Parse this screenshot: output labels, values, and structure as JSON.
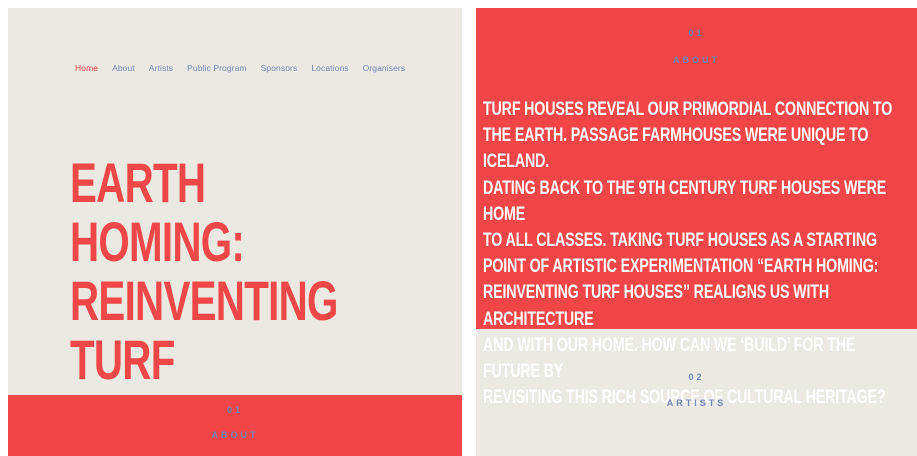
{
  "nav": {
    "items": [
      {
        "label": "Home",
        "active": true
      },
      {
        "label": "About",
        "active": false
      },
      {
        "label": "Artists",
        "active": false
      },
      {
        "label": "Public Program",
        "active": false
      },
      {
        "label": "Sponsors",
        "active": false
      },
      {
        "label": "Locations",
        "active": false
      },
      {
        "label": "Organisers",
        "active": false
      }
    ]
  },
  "hero": {
    "title": "EARTH HOMING:\nREINVENTING TURF\nHOUSES"
  },
  "left_about_section": {
    "number": "01",
    "label": "ABOUT"
  },
  "about_section": {
    "number": "01",
    "label": "ABOUT",
    "text": "TURF HOUSES REVEAL OUR PRIMORDIAL CONNECTION TO\nTHE EARTH. PASSAGE FARMHOUSES WERE UNIQUE TO ICELAND.\nDATING BACK TO THE 9TH CENTURY TURF HOUSES WERE HOME\nTO ALL CLASSES. TAKING TURF HOUSES AS A STARTING\nPOINT OF ARTISTIC EXPERIMENTATION “EARTH HOMING:\nREINVENTING TURF HOUSES” REALIGNS US WITH ARCHITECTURE\nAND WITH OUR HOME. HOW CAN WE ‘BUILD’ FOR THE FUTURE BY\nREVISITING THIS RICH SOURCE OF CULTURAL HERITAGE?"
  },
  "artists_section": {
    "number": "02",
    "label": "ARTISTS"
  },
  "colors": {
    "accent_red": "#f24547",
    "background": "#ece9e2",
    "nav_blue": "#6f86b8",
    "white": "#ffffff"
  }
}
